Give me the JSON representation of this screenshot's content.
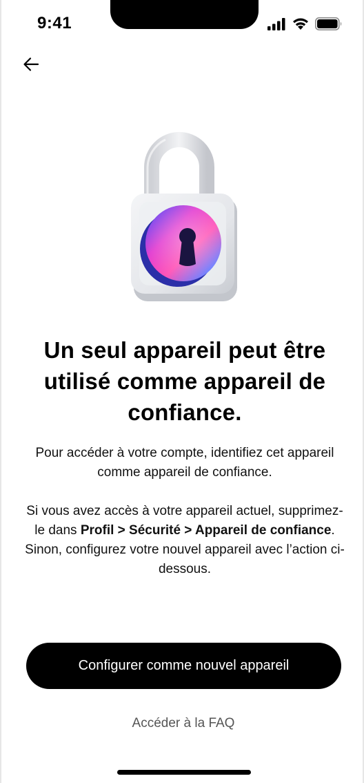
{
  "status_bar": {
    "time": "9:41"
  },
  "icons": {
    "back": "arrow-left-icon",
    "signal": "cellular-signal-icon",
    "wifi": "wifi-icon",
    "battery": "battery-icon",
    "illustration": "padlock-icon"
  },
  "content": {
    "title": "Un seul appareil peut être utilisé comme appareil de confiance.",
    "paragraph_1": "Pour accéder à votre compte, identifiez cet appareil comme appareil de confiance.",
    "paragraph_2_start": "Si vous avez accès à votre appareil actuel, supprimez-le dans ",
    "paragraph_2_bold": "Profil > Sécurité > Appareil de confiance",
    "paragraph_2_end": ". Sinon, configurez votre nouvel appareil avec l’action ci-dessous."
  },
  "actions": {
    "primary_label": "Configurer comme nouvel appareil",
    "faq_label": "Accéder à la FAQ"
  },
  "colors": {
    "primary_button": "#000000",
    "primary_text": "#ffffff",
    "link_text": "#555555",
    "lock_gradient": [
      "#ff3fbf",
      "#3c5cff",
      "#7a4dff"
    ]
  }
}
